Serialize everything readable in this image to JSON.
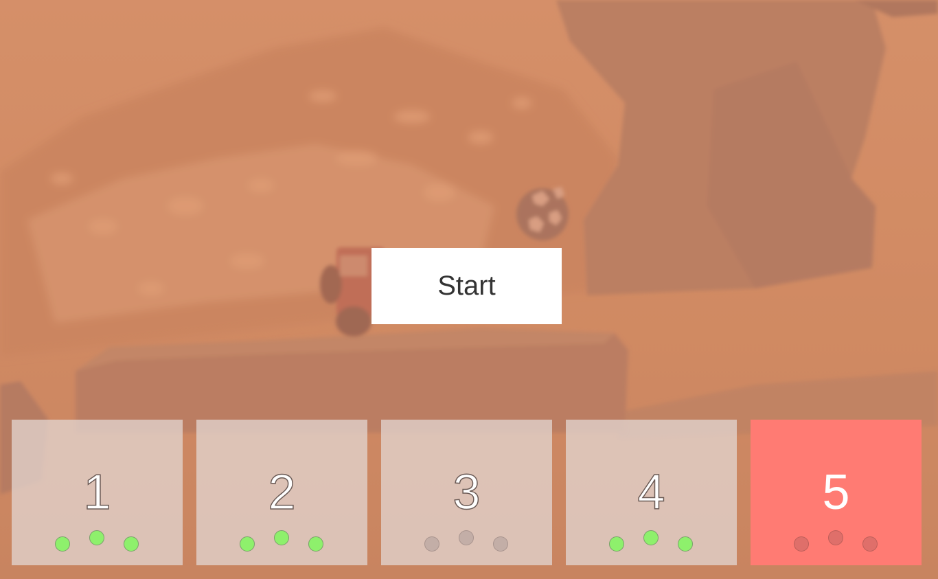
{
  "start_button": {
    "label": "Start"
  },
  "levels": [
    {
      "number": "1",
      "stars_earned": 3,
      "stars_total": 3,
      "selected": false
    },
    {
      "number": "2",
      "stars_earned": 3,
      "stars_total": 3,
      "selected": false
    },
    {
      "number": "3",
      "stars_earned": 0,
      "stars_total": 3,
      "selected": false
    },
    {
      "number": "4",
      "stars_earned": 3,
      "stars_total": 3,
      "selected": false
    },
    {
      "number": "5",
      "stars_earned": 0,
      "stars_total": 3,
      "selected": true
    }
  ],
  "colors": {
    "background": "#c98a66",
    "start_button_bg": "#ffffff",
    "start_button_text": "#333333",
    "card_bg": "#e2d4ce",
    "card_selected_bg": "#ff7b73",
    "star_earned": "#8ef06c",
    "star_empty": "#beaaa5"
  }
}
